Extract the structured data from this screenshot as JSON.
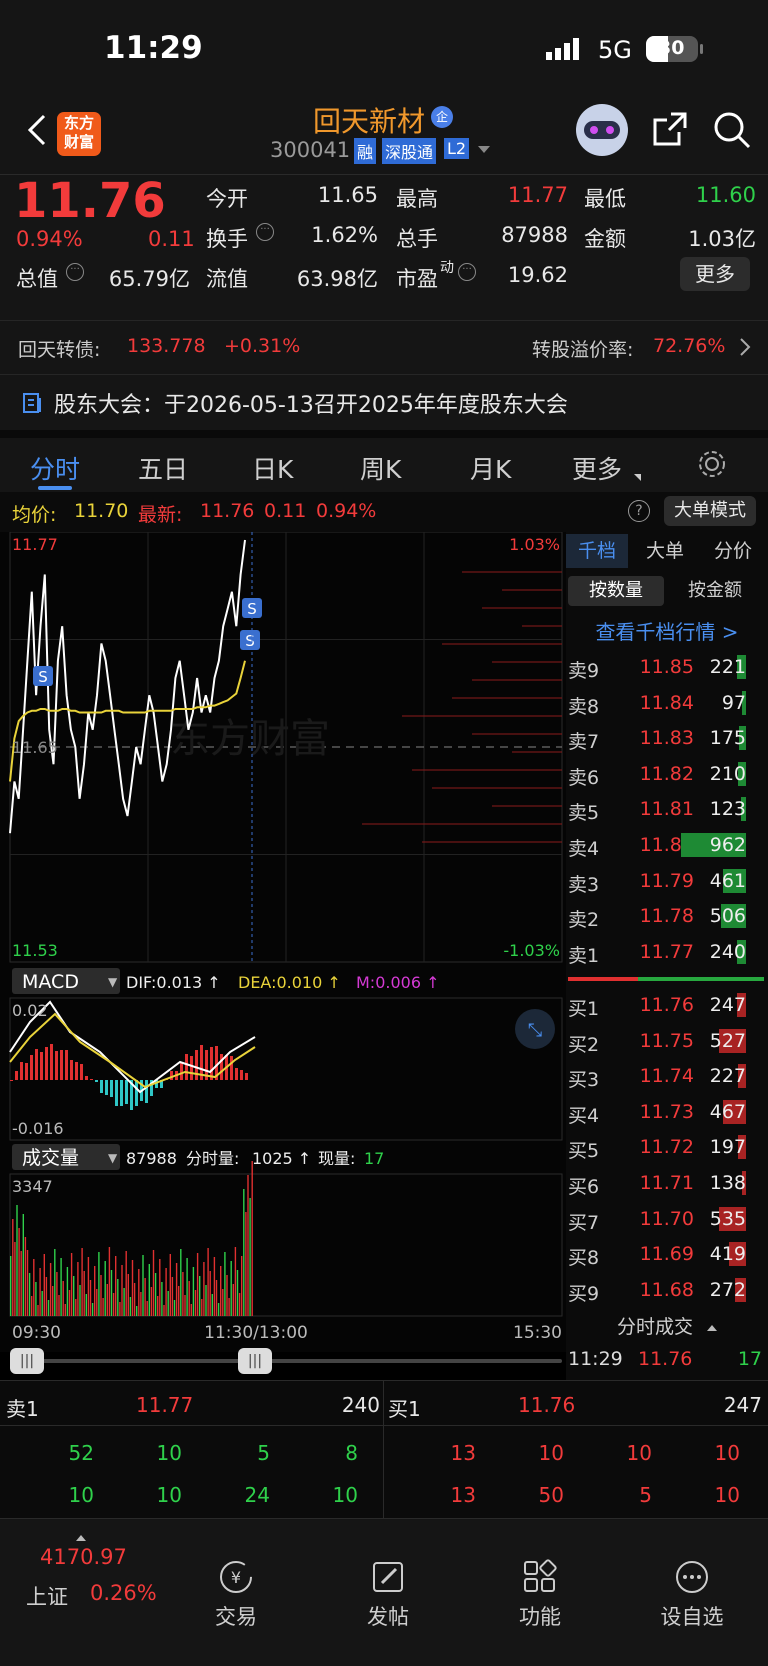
{
  "status_bar": {
    "time": "11:29",
    "network": "5G",
    "battery": "30"
  },
  "header": {
    "stock_name": "回天新材",
    "enterprise_badge": "企",
    "code": "300041",
    "tags": [
      "融",
      "深股通",
      "L2"
    ],
    "app_logo": "东方\n财富"
  },
  "quote": {
    "price": "11.76",
    "change_pct": "0.94%",
    "change": "0.11",
    "open_label": "今开",
    "open": "11.65",
    "high_label": "最高",
    "high": "11.77",
    "low_label": "最低",
    "low": "11.60",
    "turnover_label": "换手",
    "turnover": "1.62%",
    "volume_label": "总手",
    "volume": "87988",
    "amount_label": "金额",
    "amount": "1.03亿",
    "mcap_label": "总值",
    "mcap": "65.79亿",
    "float_label": "流值",
    "float": "63.98亿",
    "pe_label": "市盈",
    "pe_sup": "动",
    "pe": "19.62",
    "more_button": "更多"
  },
  "convertible": {
    "label": "回天转债:",
    "price": "133.778",
    "change": "+0.31%",
    "premium_label": "转股溢价率:",
    "premium": "72.76%"
  },
  "notice": {
    "text": "股东大会：于2026-05-13召开2025年年度股东大会"
  },
  "tabs": [
    "分时",
    "五日",
    "日K",
    "周K",
    "月K",
    "更多"
  ],
  "chart_header": {
    "avg_label": "均价:",
    "avg": "11.70",
    "latest_label": "最新:",
    "latest": "11.76",
    "chg": "0.11",
    "pct": "0.94%",
    "mode_button": "大单模式",
    "help": "?"
  },
  "chart_data": {
    "type": "line",
    "x_ticks": [
      "09:30",
      "11:30/13:00",
      "15:30"
    ],
    "price_ylim": [
      11.53,
      11.77
    ],
    "y_left_top": "11.77",
    "y_left_mid": "11.65",
    "y_left_bottom": "11.53",
    "y_right_top": "1.03%",
    "y_right_bottom": "-1.03%",
    "watermark": "东方财富",
    "series": [
      {
        "name": "price",
        "color": "#ffffff",
        "values": [
          11.6,
          11.63,
          11.62,
          11.66,
          11.7,
          11.74,
          11.68,
          11.72,
          11.75,
          11.66,
          11.64,
          11.7,
          11.72,
          11.68,
          11.66,
          11.65,
          11.62,
          11.64,
          11.67,
          11.66,
          11.68,
          11.71,
          11.7,
          11.68,
          11.66,
          11.64,
          11.62,
          11.61,
          11.63,
          11.65,
          11.64,
          11.66,
          11.68,
          11.67,
          11.65,
          11.63,
          11.64,
          11.66,
          11.69,
          11.7,
          11.68,
          11.66,
          11.67,
          11.69,
          11.67,
          11.68,
          11.67,
          11.69,
          11.7,
          11.72,
          11.73,
          11.74,
          11.72,
          11.75,
          11.77
        ]
      },
      {
        "name": "avg",
        "color": "#e9d33a",
        "values": [
          11.63,
          11.655,
          11.665,
          11.668,
          11.67,
          11.671,
          11.671,
          11.672,
          11.672,
          11.671,
          11.671,
          11.671,
          11.672,
          11.672,
          11.671,
          11.671,
          11.67,
          11.67,
          11.67,
          11.67,
          11.67,
          11.67,
          11.671,
          11.671,
          11.671,
          11.671,
          11.67,
          11.67,
          11.67,
          11.67,
          11.67,
          11.67,
          11.671,
          11.671,
          11.671,
          11.671,
          11.671,
          11.671,
          11.672,
          11.672,
          11.672,
          11.672,
          11.672,
          11.673,
          11.673,
          11.673,
          11.674,
          11.674,
          11.675,
          11.676,
          11.677,
          11.679,
          11.681,
          11.69,
          11.7
        ]
      }
    ],
    "macd": {
      "label": "MACD",
      "dif": "DIF:0.013 ↑",
      "dea": "DEA:0.010 ↑",
      "m": "M:0.006 ↑",
      "y_top": "0.02",
      "y_bottom": "-0.016"
    },
    "volume": {
      "label": "成交量",
      "total": "87988",
      "period_label": "分时量:",
      "period": "1025 ↑",
      "current_label": "现量:",
      "current": "17",
      "y_top": "3347"
    }
  },
  "orderbook": {
    "tabs": [
      "千档",
      "大单",
      "分价"
    ],
    "subtabs": [
      "按数量",
      "按金额"
    ],
    "link": "查看千档行情 >",
    "sells": [
      {
        "label": "卖9",
        "price": "11.85",
        "vol": "221",
        "pct": 0.12
      },
      {
        "label": "卖8",
        "price": "11.84",
        "vol": "97",
        "pct": 0.05
      },
      {
        "label": "卖7",
        "price": "11.83",
        "vol": "175",
        "pct": 0.09
      },
      {
        "label": "卖6",
        "price": "11.82",
        "vol": "210",
        "pct": 0.1
      },
      {
        "label": "卖5",
        "price": "11.81",
        "vol": "123",
        "pct": 0.06
      },
      {
        "label": "卖4",
        "price": "11.80",
        "vol": "962",
        "pct": 0.85
      },
      {
        "label": "卖3",
        "price": "11.79",
        "vol": "461",
        "pct": 0.3
      },
      {
        "label": "卖2",
        "price": "11.78",
        "vol": "506",
        "pct": 0.33
      },
      {
        "label": "卖1",
        "price": "11.77",
        "vol": "240",
        "pct": 0.12
      }
    ],
    "buys": [
      {
        "label": "买1",
        "price": "11.76",
        "vol": "247",
        "pct": 0.12
      },
      {
        "label": "买2",
        "price": "11.75",
        "vol": "527",
        "pct": 0.36
      },
      {
        "label": "买3",
        "price": "11.74",
        "vol": "227",
        "pct": 0.1
      },
      {
        "label": "买4",
        "price": "11.73",
        "vol": "467",
        "pct": 0.3
      },
      {
        "label": "买5",
        "price": "11.72",
        "vol": "197",
        "pct": 0.1
      },
      {
        "label": "买6",
        "price": "11.71",
        "vol": "138",
        "pct": 0.05
      },
      {
        "label": "买7",
        "price": "11.70",
        "vol": "535",
        "pct": 0.36
      },
      {
        "label": "买8",
        "price": "11.69",
        "vol": "419",
        "pct": 0.22
      },
      {
        "label": "买9",
        "price": "11.68",
        "vol": "272",
        "pct": 0.14
      }
    ],
    "trades_header": "分时成交",
    "last_trade": {
      "time": "11:29",
      "price": "11.76",
      "vol": "17"
    }
  },
  "level_detail": {
    "sell_label": "卖1",
    "sell_price": "11.77",
    "sell_vol": "240",
    "buy_label": "买1",
    "buy_price": "11.76",
    "buy_vol": "247",
    "sell_queue": [
      [
        "52",
        "10",
        "5",
        "8"
      ],
      [
        "10",
        "10",
        "24",
        "10"
      ]
    ],
    "buy_queue": [
      [
        "13",
        "10",
        "10",
        "10"
      ],
      [
        "13",
        "50",
        "5",
        "10"
      ]
    ]
  },
  "bottom_nav": {
    "index_value": "4170.97",
    "index_name": "上证",
    "index_pct": "0.26%",
    "items": [
      "交易",
      "发帖",
      "功能",
      "设自选"
    ]
  }
}
